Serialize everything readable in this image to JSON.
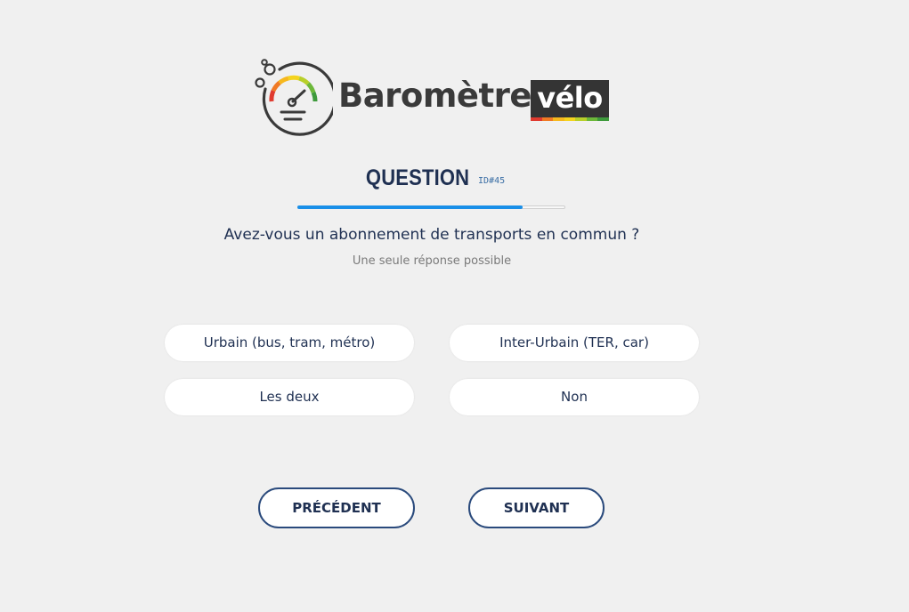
{
  "logo": {
    "word": "Baromètre",
    "badge": "vélo",
    "stripe_colors": [
      "#e03a2f",
      "#f07a24",
      "#f6b81e",
      "#f4d31e",
      "#b8cf2a",
      "#6cb83a",
      "#3e9a3c"
    ],
    "icon": "gauge-icon"
  },
  "question": {
    "title": "QUESTION",
    "id_label": "ID#45",
    "progress_fraction": 0.84,
    "text": "Avez-vous un abonnement de transports en commun ?",
    "hint": "Une seule réponse possible"
  },
  "options": [
    {
      "label": "Urbain (bus, tram, métro)"
    },
    {
      "label": "Inter-Urbain (TER, car)"
    },
    {
      "label": "Les deux"
    },
    {
      "label": "Non"
    }
  ],
  "nav": {
    "previous_label": "PRÉCÉDENT",
    "next_label": "SUIVANT"
  },
  "colors": {
    "primary_text": "#1f3052",
    "progress": "#1a8fe8",
    "button_border": "#2a4a7c",
    "background": "#f0f0f0"
  }
}
